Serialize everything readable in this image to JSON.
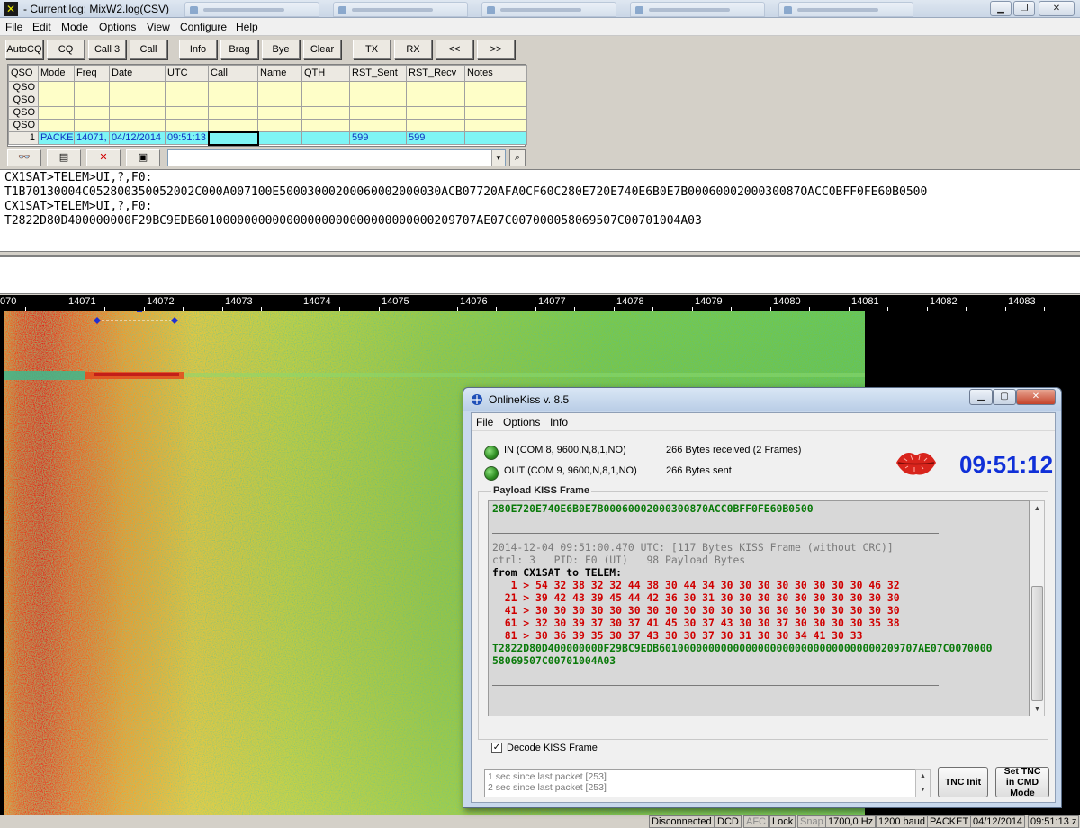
{
  "window": {
    "title": "- Current log: MixW2.log(CSV)"
  },
  "menu": [
    "File",
    "Edit",
    "Mode",
    "Options",
    "View",
    "Configure",
    "Help"
  ],
  "toolbar": {
    "buttons": [
      "AutoCQ",
      "CQ",
      "Call 3",
      "Call",
      "Info",
      "Brag",
      "Bye",
      "Clear",
      "TX",
      "RX",
      "<<",
      ">>"
    ]
  },
  "log": {
    "columns": [
      "QSO",
      "Mode",
      "Freq",
      "Date",
      "UTC",
      "Call",
      "Name",
      "QTH",
      "RST_Sent",
      "RST_Recv",
      "Notes"
    ],
    "empty_row_label": "QSO",
    "current_row": {
      "qso": "1",
      "mode": "PACKE",
      "freq": "14071,",
      "date": "04/12/2014",
      "utc": "09:51:13",
      "call": "",
      "name": "",
      "qth": "",
      "rst_sent": "599",
      "rst_recv": "599",
      "notes": ""
    }
  },
  "search": {
    "value": ""
  },
  "rx": {
    "lines": [
      "CX1SAT>TELEM>UI,?,F0:",
      "T1B70130004C052800350052002C000A007100E50003000200060002000030ACB07720AFA0CF60C280E720E740E6B0E7B0006000200030087OACC0BFF0FE60B0500",
      "CX1SAT>TELEM>UI,?,F0:",
      "T2822D80D400000000F29BC9EDB6010000000000000000000000000000000209707AE07C007000058069507C00701004A03"
    ]
  },
  "freq_scale": {
    "left_stub": "070",
    "labels": [
      "14071",
      "14072",
      "14073",
      "14074",
      "14075",
      "14076",
      "14077",
      "14078",
      "14079",
      "14080",
      "14081",
      "14082",
      "14083"
    ]
  },
  "statusbar": {
    "items": [
      "Disconnected",
      "DCD",
      "AFC",
      "Lock",
      "Snap",
      "1700,0 Hz",
      "1200 baud",
      "PACKET",
      "04/12/2014",
      "09:51:13 z"
    ]
  },
  "kiss": {
    "title": "OnlineKiss v. 8.5",
    "menu": [
      "File",
      "Options",
      "Info"
    ],
    "in_port": "IN (COM 8, 9600,N,8,1,NO)",
    "out_port": "OUT (COM 9, 9600,N,8,1,NO)",
    "received": "266 Bytes received (2 Frames)",
    "sent": "266 Bytes sent",
    "clock": "09:51:12",
    "payload_legend": "Payload KISS Frame",
    "payload": {
      "top_line": "280E720E740E6B0E7B00060002000300870ACC0BFF0FE60B0500",
      "header_line": "2014-12-04 09:51:00.470 UTC: [117 Bytes KISS Frame (without CRC)]",
      "ctrl_line": "ctrl: 3   PID: F0 (UI)   98 Payload Bytes",
      "from_line": "from CX1SAT to TELEM:",
      "hex_rows": [
        "   1 > 54 32 38 32 32 44 38 30 44 34 30 30 30 30 30 30 30 30 46 32",
        "  21 > 39 42 43 39 45 44 42 36 30 31 30 30 30 30 30 30 30 30 30 30",
        "  41 > 30 30 30 30 30 30 30 30 30 30 30 30 30 30 30 30 30 30 30 30",
        "  61 > 32 30 39 37 30 37 41 45 30 37 43 30 30 37 30 30 30 30 35 38",
        "  81 > 30 36 39 35 30 37 43 30 30 37 30 31 30 30 34 41 30 33"
      ],
      "decoded_1": "T2822D80D400000000F29BC9EDB601000000000000000000000000000000000209707AE07C0070000",
      "decoded_2": "58069507C00701004A03"
    },
    "decode_label": "Decode KISS Frame",
    "decode_checked": true,
    "status_log": [
      "1 sec since last packet [253]",
      "2 sec since last packet [253]"
    ],
    "tnc_init": "TNC Init",
    "tnc_cmd": "Set TNC in CMD Mode"
  }
}
